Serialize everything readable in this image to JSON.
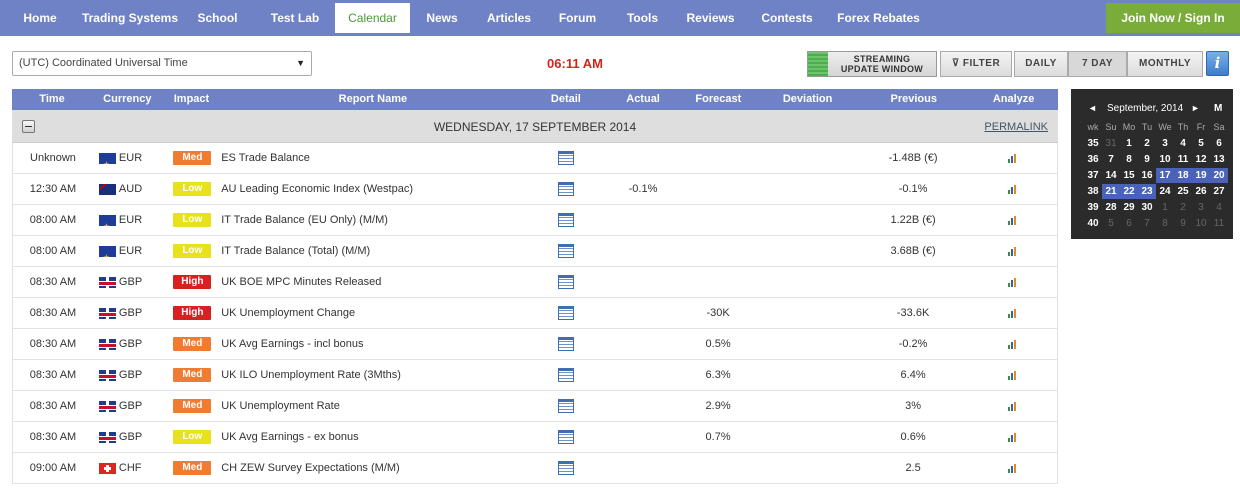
{
  "nav": {
    "items": [
      {
        "label": "Home",
        "w": 80
      },
      {
        "label": "Trading Systems",
        "w": 100
      },
      {
        "label": "School",
        "w": 75
      },
      {
        "label": "Test Lab",
        "w": 80
      },
      {
        "label": "Calendar",
        "w": 75,
        "active": true
      },
      {
        "label": "News",
        "w": 64
      },
      {
        "label": "Articles",
        "w": 70
      },
      {
        "label": "Forum",
        "w": 67
      },
      {
        "label": "Tools",
        "w": 63
      },
      {
        "label": "Reviews",
        "w": 73
      },
      {
        "label": "Contests",
        "w": 80
      },
      {
        "label": "Forex Rebates",
        "w": 103
      }
    ],
    "join_label": "Join Now / Sign In"
  },
  "toolbar": {
    "timezone": "(UTC) Coordinated Universal Time",
    "clock": "06:11 AM",
    "streaming_line1": "STREAMING",
    "streaming_line2": "UPDATE WINDOW",
    "filter_label": "FILTER",
    "daily_label": "DAILY",
    "seven_day_label": "7 DAY",
    "monthly_label": "MONTHLY",
    "info_label": "i"
  },
  "table": {
    "headers": {
      "time": "Time",
      "currency": "Currency",
      "impact": "Impact",
      "name": "Report Name",
      "detail": "Detail",
      "actual": "Actual",
      "forecast": "Forecast",
      "deviation": "Deviation",
      "previous": "Previous",
      "analyze": "Analyze"
    },
    "day_title": "WEDNESDAY, 17 SEPTEMBER 2014",
    "permalink": "PERMALINK",
    "rows": [
      {
        "time": "Unknown",
        "flag": "eur",
        "currency": "EUR",
        "impact": "Med",
        "name": "ES Trade Balance",
        "actual": "",
        "forecast": "",
        "deviation": "",
        "previous": "-1.48B (€)"
      },
      {
        "time": "12:30 AM",
        "flag": "aud",
        "currency": "AUD",
        "impact": "Low",
        "name": "AU Leading Economic Index (Westpac)",
        "actual": "-0.1%",
        "forecast": "",
        "deviation": "",
        "previous": "-0.1%"
      },
      {
        "time": "08:00 AM",
        "flag": "eur",
        "currency": "EUR",
        "impact": "Low",
        "name": "IT Trade Balance (EU Only) (M/M)",
        "actual": "",
        "forecast": "",
        "deviation": "",
        "previous": "1.22B (€)"
      },
      {
        "time": "08:00 AM",
        "flag": "eur",
        "currency": "EUR",
        "impact": "Low",
        "name": "IT Trade Balance (Total) (M/M)",
        "actual": "",
        "forecast": "",
        "deviation": "",
        "previous": "3.68B (€)"
      },
      {
        "time": "08:30 AM",
        "flag": "gbp",
        "currency": "GBP",
        "impact": "High",
        "name": "UK BOE MPC Minutes Released",
        "actual": "",
        "forecast": "",
        "deviation": "",
        "previous": ""
      },
      {
        "time": "08:30 AM",
        "flag": "gbp",
        "currency": "GBP",
        "impact": "High",
        "name": "UK Unemployment Change",
        "actual": "",
        "forecast": "-30K",
        "deviation": "",
        "previous": "-33.6K"
      },
      {
        "time": "08:30 AM",
        "flag": "gbp",
        "currency": "GBP",
        "impact": "Med",
        "name": "UK Avg Earnings - incl bonus",
        "actual": "",
        "forecast": "0.5%",
        "deviation": "",
        "previous": "-0.2%"
      },
      {
        "time": "08:30 AM",
        "flag": "gbp",
        "currency": "GBP",
        "impact": "Med",
        "name": "UK ILO Unemployment Rate (3Mths)",
        "actual": "",
        "forecast": "6.3%",
        "deviation": "",
        "previous": "6.4%"
      },
      {
        "time": "08:30 AM",
        "flag": "gbp",
        "currency": "GBP",
        "impact": "Med",
        "name": "UK Unemployment Rate",
        "actual": "",
        "forecast": "2.9%",
        "deviation": "",
        "previous": "3%"
      },
      {
        "time": "08:30 AM",
        "flag": "gbp",
        "currency": "GBP",
        "impact": "Low",
        "name": "UK Avg Earnings - ex bonus",
        "actual": "",
        "forecast": "0.7%",
        "deviation": "",
        "previous": "0.6%"
      },
      {
        "time": "09:00 AM",
        "flag": "chf",
        "currency": "CHF",
        "impact": "Med",
        "name": "CH ZEW Survey Expectations (M/M)",
        "actual": "",
        "forecast": "",
        "deviation": "",
        "previous": "2.5"
      }
    ]
  },
  "calendar": {
    "prev": "◄",
    "title": "September, 2014",
    "next": "►",
    "mode": "M",
    "day_headers": [
      "wk",
      "Su",
      "Mo",
      "Tu",
      "We",
      "Th",
      "Fr",
      "Sa"
    ],
    "weeks": [
      [
        {
          "t": "35",
          "c": "wk"
        },
        {
          "t": "31",
          "c": "dim"
        },
        {
          "t": "1"
        },
        {
          "t": "2"
        },
        {
          "t": "3"
        },
        {
          "t": "4"
        },
        {
          "t": "5"
        },
        {
          "t": "6"
        }
      ],
      [
        {
          "t": "36",
          "c": "wk"
        },
        {
          "t": "7"
        },
        {
          "t": "8"
        },
        {
          "t": "9"
        },
        {
          "t": "10"
        },
        {
          "t": "11"
        },
        {
          "t": "12"
        },
        {
          "t": "13"
        }
      ],
      [
        {
          "t": "37",
          "c": "wk"
        },
        {
          "t": "14"
        },
        {
          "t": "15"
        },
        {
          "t": "16"
        },
        {
          "t": "17",
          "c": "sel"
        },
        {
          "t": "18",
          "c": "sel"
        },
        {
          "t": "19",
          "c": "sel"
        },
        {
          "t": "20",
          "c": "sel"
        }
      ],
      [
        {
          "t": "38",
          "c": "wk"
        },
        {
          "t": "21",
          "c": "sel"
        },
        {
          "t": "22",
          "c": "sel"
        },
        {
          "t": "23",
          "c": "sel"
        },
        {
          "t": "24"
        },
        {
          "t": "25"
        },
        {
          "t": "26"
        },
        {
          "t": "27"
        }
      ],
      [
        {
          "t": "39",
          "c": "wk"
        },
        {
          "t": "28"
        },
        {
          "t": "29"
        },
        {
          "t": "30"
        },
        {
          "t": "1",
          "c": "dim"
        },
        {
          "t": "2",
          "c": "dim"
        },
        {
          "t": "3",
          "c": "dim"
        },
        {
          "t": "4",
          "c": "dim"
        }
      ],
      [
        {
          "t": "40",
          "c": "wk"
        },
        {
          "t": "5",
          "c": "dim"
        },
        {
          "t": "6",
          "c": "dim"
        },
        {
          "t": "7",
          "c": "dim"
        },
        {
          "t": "8",
          "c": "dim"
        },
        {
          "t": "9",
          "c": "dim"
        },
        {
          "t": "10",
          "c": "dim"
        },
        {
          "t": "11",
          "c": "dim"
        }
      ]
    ]
  }
}
